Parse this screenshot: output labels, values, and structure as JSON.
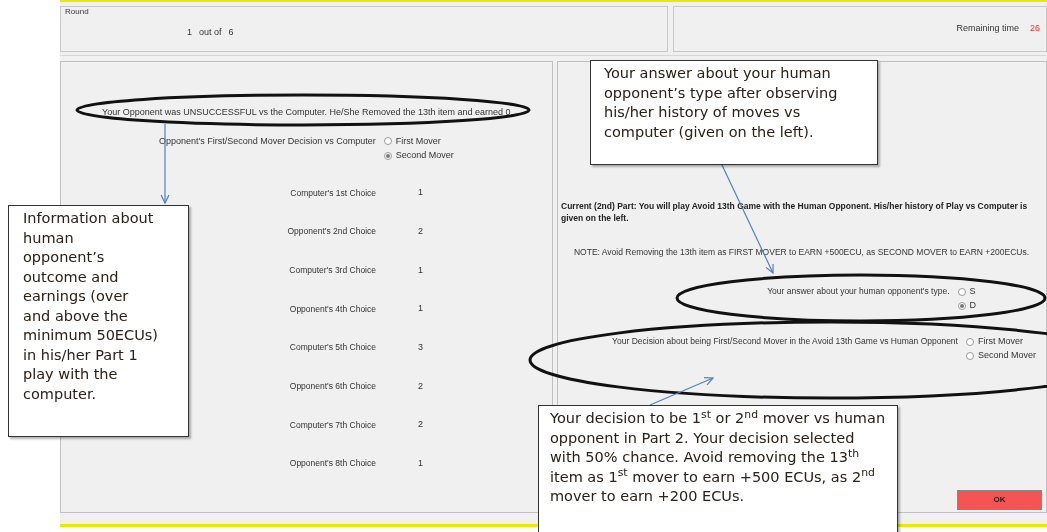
{
  "round": {
    "label": "Round",
    "current": "1",
    "out_of": "out of",
    "total": "6"
  },
  "timer": {
    "label": "Remaining time",
    "value": "26"
  },
  "left_panel": {
    "outcome": "Your Opponent was UNSUCCESSFUL vs the Computer. He/She Removed the 13th item and earned 0.",
    "decision": {
      "label": "Opponent's First/Second Mover Decision vs Computer",
      "options": [
        {
          "label": "First Mover",
          "selected": false
        },
        {
          "label": "Second Mover",
          "selected": true
        }
      ]
    },
    "choices": [
      {
        "label": "Computer's 1st Choice",
        "value": "1"
      },
      {
        "label": "Opponent's 2nd Choice",
        "value": "2"
      },
      {
        "label": "Computer's 3rd Choice",
        "value": "1"
      },
      {
        "label": "Opponent's 4th Choice",
        "value": "1"
      },
      {
        "label": "Computer's 5th Choice",
        "value": "3"
      },
      {
        "label": "Opponent's 6th Choice",
        "value": "2"
      },
      {
        "label": "Computer's 7th Choice",
        "value": "2"
      },
      {
        "label": "Opponent's 8th Choice",
        "value": "1"
      }
    ]
  },
  "right_panel": {
    "intro": "Current (2nd) Part: You will play Avoid 13th Game with the Human Opponent. His/her history of Play vs Computer is given on the left.",
    "note": "NOTE: Avoid Removing the 13th item as  FIRST MOVER to EARN +500ECU, as SECOND MOVER to EARN +200ECUs.",
    "type_question": {
      "label": "Your answer about your human opponent's type.",
      "options": [
        {
          "label": "S",
          "selected": false
        },
        {
          "label": "D",
          "selected": true
        }
      ]
    },
    "mover_question": {
      "label": "Your Decision about being First/Second Mover in the Avoid 13th Game vs Human Opponent",
      "options": [
        {
          "label": "First Mover",
          "selected": false
        },
        {
          "label": "Second Mover",
          "selected": false
        }
      ]
    },
    "ok_button": "OK"
  },
  "annotations": [
    {
      "text": "Information about human opponent’s outcome and earnings (over and above the minimum 50ECUs) in his/her Part 1 play with the computer."
    },
    {
      "text": "Your answer about your human opponent’s type after observing his/her history of moves vs computer (given on the left)."
    },
    {
      "text": "Your decision to be 1$^{st}$ or 2$^{nd}$ mover vs human opponent in Part 2. Your decision selected with 50% chance. Avoid removing the 13$^{th}$ item as 1$^{st}$ mover to earn +500 ECUs, as 2$^{nd}$ mover to earn +200 ECUs."
    }
  ]
}
